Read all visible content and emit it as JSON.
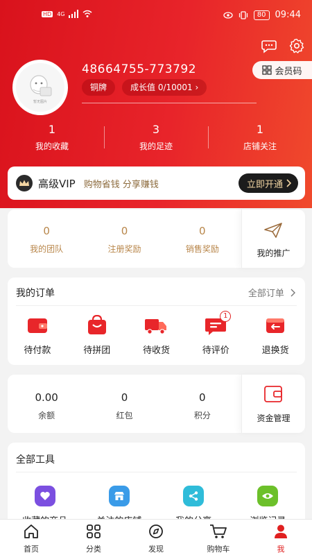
{
  "status_bar": {
    "left_labels": [
      "HD",
      "4G"
    ],
    "battery": "80",
    "time": "09:44"
  },
  "header": {
    "username": "48664755-773792",
    "level": "铜牌",
    "growth": "成长值 0/10001 ›",
    "member_code": "会员码",
    "icons": [
      "message-icon",
      "settings-icon"
    ],
    "avatar_caption": "暂无图片",
    "colors": {
      "start": "#d9121c",
      "end": "#f04a2c"
    }
  },
  "stats": [
    {
      "value": "1",
      "label": "我的收藏"
    },
    {
      "value": "3",
      "label": "我的足迹"
    },
    {
      "value": "1",
      "label": "店铺关注"
    }
  ],
  "vip": {
    "title": "高级VIP",
    "subtitle": "购物省钱 分享赚钱",
    "button": "立即开通"
  },
  "team": {
    "items": [
      {
        "value": "0",
        "label": "我的团队"
      },
      {
        "value": "0",
        "label": "注册奖励"
      },
      {
        "value": "0",
        "label": "销售奖励"
      }
    ],
    "promo_label": "我的推广"
  },
  "orders": {
    "title": "我的订单",
    "all_label": "全部订单",
    "items": [
      {
        "label": "待付款",
        "icon": "wallet-icon"
      },
      {
        "label": "待拼团",
        "icon": "shopping-bag-icon"
      },
      {
        "label": "待收货",
        "icon": "truck-icon"
      },
      {
        "label": "待评价",
        "icon": "comment-icon",
        "badge": "1"
      },
      {
        "label": "退换货",
        "icon": "return-icon"
      }
    ]
  },
  "money": {
    "items": [
      {
        "value": "0.00",
        "label": "余额"
      },
      {
        "value": "0",
        "label": "红包"
      },
      {
        "value": "0",
        "label": "积分"
      }
    ],
    "fund_label": "资金管理"
  },
  "tools": {
    "title": "全部工具",
    "items": [
      {
        "label": "收藏的商品",
        "icon": "heart-icon",
        "color": "#7b4fe0"
      },
      {
        "label": "关注的店铺",
        "icon": "store-icon",
        "color": "#3a9be8"
      },
      {
        "label": "我的分享",
        "icon": "share-icon",
        "color": "#2fbcd9"
      },
      {
        "label": "浏览记录",
        "icon": "eye-icon",
        "color": "#6cc02a"
      }
    ]
  },
  "tabbar": [
    {
      "label": "首页",
      "icon": "home-icon"
    },
    {
      "label": "分类",
      "icon": "grid-icon"
    },
    {
      "label": "发现",
      "icon": "compass-icon"
    },
    {
      "label": "购物车",
      "icon": "cart-icon"
    },
    {
      "label": "我",
      "icon": "user-icon",
      "active": true
    }
  ]
}
